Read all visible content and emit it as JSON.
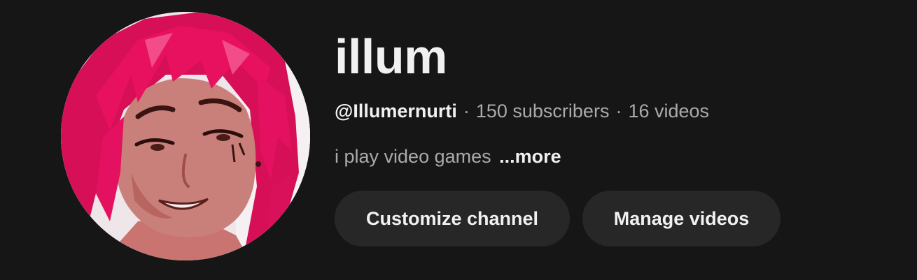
{
  "channel": {
    "name": "illum",
    "handle": "@Illumernurti",
    "subscribers": "150 subscribers",
    "videos": "16 videos",
    "separator": "·",
    "description": "i play video games",
    "more_label": "...more"
  },
  "actions": {
    "customize_label": "Customize channel",
    "manage_label": "Manage videos"
  },
  "colors": {
    "background": "#161616",
    "text_primary": "#f1f1f1",
    "text_secondary": "#aaaaaa",
    "button_bg": "#272727",
    "hair": "#e3115f",
    "skin": "#c97b73"
  }
}
